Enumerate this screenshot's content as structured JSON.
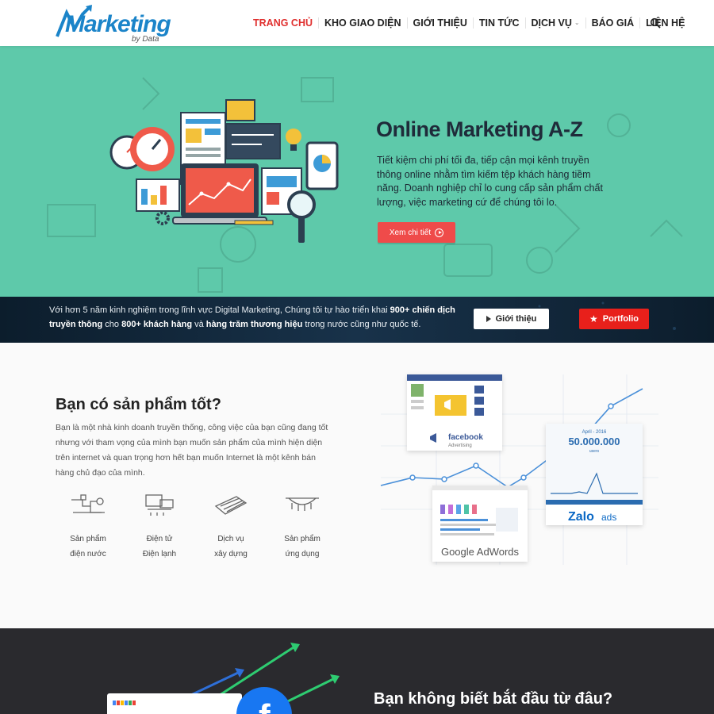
{
  "header": {
    "logo_text": "Marketing",
    "logo_sub": "by Data",
    "nav": [
      {
        "label": "TRANG CHỦ",
        "active": true
      },
      {
        "label": "KHO GIAO DIỆN"
      },
      {
        "label": "GIỚI THIỆU"
      },
      {
        "label": "TIN TỨC"
      },
      {
        "label": "DỊCH VỤ",
        "has_dropdown": true
      },
      {
        "label": "BÁO GIÁ"
      },
      {
        "label": "LIÊN HỆ"
      }
    ],
    "search_icon": "search-icon"
  },
  "hero": {
    "title": "Online Marketing A-Z",
    "description": "Tiết kiệm chi phí tối đa, tiếp cận mọi kênh truyền thông online nhằm tìm kiếm tệp khách hàng tiềm năng. Doanh nghiệp chỉ lo cung cấp sản phẩm chất lượng, việc marketing cứ để chúng tôi lo.",
    "button_label": "Xem chi tiết",
    "background_color": "#5ec9aa"
  },
  "strip": {
    "text_1": "Với hơn 5 năm kinh nghiệm trong lĩnh vực Digital Marketing, Chúng tôi tự hào triển khai ",
    "bold_1": "900+ chiến dịch truyền thông",
    "text_2": " cho ",
    "bold_2": "800+ khách hàng",
    "text_3": " và ",
    "bold_3": "hàng trăm thương hiệu",
    "text_4": " trong nước cũng như quốc tế.",
    "intro_button": "Giới thiệu",
    "portfolio_button": "Portfolio"
  },
  "product": {
    "title": "Bạn có sản phẩm tốt?",
    "description": "Bạn là một nhà kinh doanh truyền thống, công việc của bạn cũng đang tốt nhưng với tham vọng của mình bạn muốn sản phẩm của mình hiện diện trên internet và quan trọng hơn hết bạn muốn Internet là một kênh bán hàng chủ đạo của mình.",
    "services": [
      {
        "line1": "Sản phẩm",
        "line2": "điện nước",
        "icon": "plumbing-icon"
      },
      {
        "line1": "Điện tử",
        "line2": "Điện lạnh",
        "icon": "electronics-icon"
      },
      {
        "line1": "Dịch vụ",
        "line2": "xây dựng",
        "icon": "construction-icon"
      },
      {
        "line1": "Sản phẩm",
        "line2": "ứng dụng",
        "icon": "application-icon"
      }
    ],
    "art": {
      "facebook_label": "facebook",
      "facebook_sub": "Advertising",
      "zalo_date": "April - 2016",
      "zalo_number": "50.000.000",
      "zalo_unit": "users",
      "zalo_label": "Zalo",
      "zalo_ads": "ads",
      "adwords_label": "Google AdWords"
    }
  },
  "bottom": {
    "title": "Bạn không biết bắt đầu từ đâu?"
  }
}
